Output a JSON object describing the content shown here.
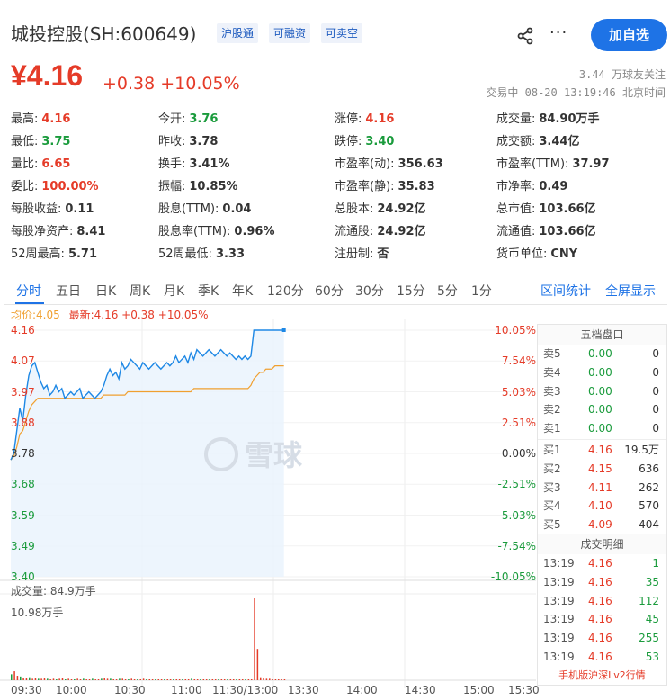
{
  "header": {
    "title": "城投控股(SH:600649)",
    "tags": [
      "沪股通",
      "可融资",
      "可卖空"
    ],
    "follow_button": "加自选",
    "more": "···"
  },
  "quote": {
    "price": "¥4.16",
    "change": "+0.38 +10.05%",
    "followers": "3.44 万球友关注",
    "status": "交易中 08-20 13:19:46 北京时间"
  },
  "stats": [
    [
      {
        "label": "最高:",
        "value": "4.16",
        "color": "red"
      },
      {
        "label": "今开:",
        "value": "3.76",
        "color": "green"
      },
      {
        "label": "涨停:",
        "value": "4.16",
        "color": "red"
      },
      {
        "label": "成交量:",
        "value": "84.90万手",
        "color": ""
      }
    ],
    [
      {
        "label": "最低:",
        "value": "3.75",
        "color": "green"
      },
      {
        "label": "昨收:",
        "value": "3.78",
        "color": ""
      },
      {
        "label": "跌停:",
        "value": "3.40",
        "color": "green"
      },
      {
        "label": "成交额:",
        "value": "3.44亿",
        "color": ""
      }
    ],
    [
      {
        "label": "量比:",
        "value": "6.65",
        "color": "red"
      },
      {
        "label": "换手:",
        "value": "3.41%",
        "color": ""
      },
      {
        "label": "市盈率(动):",
        "value": "356.63",
        "color": ""
      },
      {
        "label": "市盈率(TTM):",
        "value": "37.97",
        "color": ""
      }
    ],
    [
      {
        "label": "委比:",
        "value": "100.00%",
        "color": "red"
      },
      {
        "label": "振幅:",
        "value": "10.85%",
        "color": ""
      },
      {
        "label": "市盈率(静):",
        "value": "35.83",
        "color": ""
      },
      {
        "label": "市净率:",
        "value": "0.49",
        "color": ""
      }
    ],
    [
      {
        "label": "每股收益:",
        "value": "0.11",
        "color": ""
      },
      {
        "label": "股息(TTM):",
        "value": "0.04",
        "color": ""
      },
      {
        "label": "总股本:",
        "value": "24.92亿",
        "color": ""
      },
      {
        "label": "总市值:",
        "value": "103.66亿",
        "color": ""
      }
    ],
    [
      {
        "label": "每股净资产:",
        "value": "8.41",
        "color": ""
      },
      {
        "label": "股息率(TTM):",
        "value": "0.96%",
        "color": ""
      },
      {
        "label": "流通股:",
        "value": "24.92亿",
        "color": ""
      },
      {
        "label": "流通值:",
        "value": "103.66亿",
        "color": ""
      }
    ],
    [
      {
        "label": "52周最高:",
        "value": "5.71",
        "color": ""
      },
      {
        "label": "52周最低:",
        "value": "3.33",
        "color": ""
      },
      {
        "label": "注册制:",
        "value": "否",
        "color": ""
      },
      {
        "label": "货币单位:",
        "value": "CNY",
        "color": ""
      }
    ]
  ],
  "tabs": [
    "分时",
    "五日",
    "日K",
    "周K",
    "月K",
    "季K",
    "年K",
    "120分",
    "60分",
    "30分",
    "15分",
    "5分",
    "1分"
  ],
  "tab_links": [
    "区间统计",
    "全屏显示"
  ],
  "legend": {
    "avg": "均价:4.05",
    "latest": "最新:4.16 +0.38 +10.05%"
  },
  "watermark": "雪球",
  "chart_data": {
    "type": "line",
    "y_labels": [
      "4.16",
      "4.07",
      "3.97",
      "3.88",
      "3.78",
      "3.68",
      "3.59",
      "3.49",
      "3.40"
    ],
    "pct_labels": [
      "10.05%",
      "7.54%",
      "5.03%",
      "2.51%",
      "0.00%",
      "-2.51%",
      "-5.03%",
      "-7.54%",
      "-10.05%"
    ],
    "ylim": [
      3.4,
      4.16
    ],
    "x_labels": [
      "09:30",
      "10:00",
      "10:30",
      "11:00",
      "11:30/13:00",
      "13:30",
      "14:00",
      "14:30",
      "15:00",
      "15:30"
    ],
    "series": [
      {
        "name": "最新",
        "color": "#1e88e5",
        "values": [
          3.76,
          3.78,
          3.85,
          3.92,
          3.88,
          3.96,
          4.02,
          4.05,
          4.06,
          4.03,
          4.0,
          3.98,
          3.99,
          3.96,
          3.97,
          3.99,
          3.97,
          3.98,
          3.95,
          3.96,
          3.97,
          3.96,
          3.97,
          3.98,
          3.95,
          3.96,
          3.97,
          3.96,
          3.95,
          3.96,
          3.97,
          3.99,
          4.02,
          4.04,
          4.02,
          4.03,
          4.01,
          4.06,
          4.04,
          4.05,
          4.07,
          4.06,
          4.05,
          4.04,
          4.06,
          4.05,
          4.04,
          4.05,
          4.06,
          4.05,
          4.04,
          4.05,
          4.06,
          4.05,
          4.06,
          4.08,
          4.06,
          4.07,
          4.08,
          4.06,
          4.09,
          4.07,
          4.1,
          4.09,
          4.08,
          4.09,
          4.1,
          4.09,
          4.08,
          4.09,
          4.1,
          4.09,
          4.08,
          4.09,
          4.08,
          4.07,
          4.08,
          4.07,
          4.08,
          4.07,
          4.08,
          4.16,
          4.16,
          4.16,
          4.16,
          4.16,
          4.16,
          4.16,
          4.16,
          4.16,
          4.16,
          4.16
        ]
      },
      {
        "name": "均价",
        "color": "#f0a030",
        "values": [
          3.76,
          3.77,
          3.8,
          3.84,
          3.85,
          3.88,
          3.91,
          3.93,
          3.94,
          3.95,
          3.95,
          3.95,
          3.95,
          3.95,
          3.95,
          3.95,
          3.95,
          3.95,
          3.95,
          3.95,
          3.95,
          3.95,
          3.95,
          3.95,
          3.95,
          3.95,
          3.95,
          3.95,
          3.95,
          3.95,
          3.95,
          3.96,
          3.96,
          3.96,
          3.96,
          3.96,
          3.96,
          3.96,
          3.96,
          3.97,
          3.97,
          3.97,
          3.97,
          3.97,
          3.97,
          3.97,
          3.97,
          3.97,
          3.97,
          3.97,
          3.97,
          3.97,
          3.97,
          3.97,
          3.97,
          3.97,
          3.97,
          3.97,
          3.97,
          3.97,
          3.97,
          3.98,
          3.98,
          3.98,
          3.98,
          3.98,
          3.98,
          3.98,
          3.98,
          3.98,
          3.98,
          3.98,
          3.98,
          3.98,
          3.98,
          3.98,
          3.98,
          3.98,
          3.98,
          3.98,
          3.99,
          4.01,
          4.02,
          4.03,
          4.03,
          4.04,
          4.04,
          4.04,
          4.05,
          4.05,
          4.05,
          4.05
        ]
      }
    ],
    "volume": {
      "label": "成交量: 84.9万手",
      "max_label": "10.98万手",
      "values": [
        0.8,
        1.2,
        0.6,
        0.5,
        0.3,
        0.3,
        0.4,
        0.2,
        0.3,
        0.2,
        0.2,
        0.3,
        0.2,
        0.1,
        0.2,
        0.1,
        0.2,
        0.3,
        0.1,
        0.2,
        0.1,
        0.1,
        0.2,
        0.1,
        0.2,
        0.1,
        0.1,
        0.2,
        0.1,
        0.1,
        0.2,
        0.3,
        0.2,
        0.2,
        0.1,
        0.1,
        0.2,
        0.2,
        0.1,
        0.1,
        0.2,
        0.1,
        0.1,
        0.1,
        0.2,
        0.1,
        0.1,
        0.1,
        0.1,
        0.1,
        0.1,
        0.1,
        0.1,
        0.1,
        0.1,
        0.1,
        0.1,
        0.1,
        0.1,
        0.1,
        0.2,
        0.1,
        0.1,
        0.1,
        0.1,
        0.1,
        0.1,
        0.1,
        0.1,
        0.1,
        0.1,
        0.1,
        0.1,
        0.1,
        0.1,
        0.1,
        0.1,
        0.1,
        0.1,
        0.1,
        0.1,
        10.98,
        4.2,
        0.4,
        0.3,
        0.2,
        0.2,
        0.1,
        0.1,
        0.1,
        0.1,
        0.1
      ]
    }
  },
  "order_book": {
    "title": "五档盘口",
    "asks": [
      {
        "label": "卖5",
        "price": "0.00",
        "vol": "0"
      },
      {
        "label": "卖4",
        "price": "0.00",
        "vol": "0"
      },
      {
        "label": "卖3",
        "price": "0.00",
        "vol": "0"
      },
      {
        "label": "卖2",
        "price": "0.00",
        "vol": "0"
      },
      {
        "label": "卖1",
        "price": "0.00",
        "vol": "0"
      }
    ],
    "bids": [
      {
        "label": "买1",
        "price": "4.16",
        "vol": "19.5万"
      },
      {
        "label": "买2",
        "price": "4.15",
        "vol": "636"
      },
      {
        "label": "买3",
        "price": "4.11",
        "vol": "262"
      },
      {
        "label": "买4",
        "price": "4.10",
        "vol": "570"
      },
      {
        "label": "买5",
        "price": "4.09",
        "vol": "404"
      }
    ],
    "trades_title": "成交明细",
    "trades": [
      {
        "time": "13:19",
        "price": "4.16",
        "vol": "1"
      },
      {
        "time": "13:19",
        "price": "4.16",
        "vol": "35"
      },
      {
        "time": "13:19",
        "price": "4.16",
        "vol": "112"
      },
      {
        "time": "13:19",
        "price": "4.16",
        "vol": "45"
      },
      {
        "time": "13:19",
        "price": "4.16",
        "vol": "255"
      },
      {
        "time": "13:19",
        "price": "4.16",
        "vol": "53"
      }
    ],
    "footer": "手机版沪深Lv2行情"
  },
  "colors": {
    "up": "#e53b28",
    "down": "#1a9b3c",
    "accent": "#1e73e6"
  }
}
